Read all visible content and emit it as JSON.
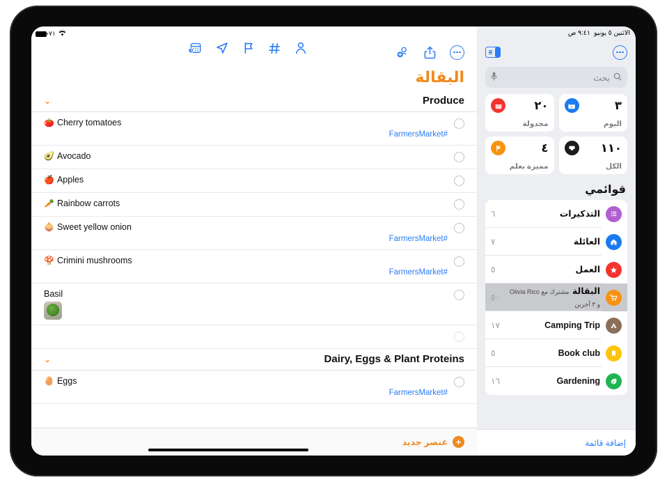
{
  "status_bar": {
    "battery_percent": "٧١",
    "battery_icon": "battery-icon",
    "wifi_icon": "wifi-icon",
    "time": "٩:٤١ ص",
    "date": "الاثنين ٥ يونيو"
  },
  "sidebar": {
    "more_button": "more-circle-icon",
    "sidebar_toggle": "sidebar-toggle-icon",
    "search": {
      "placeholder": "بحث",
      "search_icon": "search-icon",
      "mic_icon": "microphone-icon"
    },
    "widgets": [
      {
        "count": "٣",
        "label": "اليوم",
        "icon": "calendar-day-icon",
        "color": "#1a7af0"
      },
      {
        "count": "٢٠",
        "label": "مجدولة",
        "icon": "calendar-icon",
        "color": "#f5332e"
      },
      {
        "count": "١١٠",
        "label": "الكل",
        "icon": "inbox-icon",
        "color": "#1c1c1e"
      },
      {
        "count": "٤",
        "label": "مميزة بعلم",
        "icon": "flag-icon",
        "color": "#f79212"
      }
    ],
    "lists_title": "قوائمي",
    "lists": [
      {
        "name": "التذكيرات",
        "count": "٦",
        "icon": "list-bullet-icon",
        "color": "#b05ed0",
        "subtitle": "",
        "selected": false
      },
      {
        "name": "العائلة",
        "count": "٧",
        "icon": "house-icon",
        "color": "#1a7af0",
        "subtitle": "",
        "selected": false
      },
      {
        "name": "العمل",
        "count": "٥",
        "icon": "star-icon",
        "color": "#f5332e",
        "subtitle": "",
        "selected": false
      },
      {
        "name": "البقالة",
        "count": "٥٠",
        "icon": "shopping-cart-icon",
        "color": "#f79212",
        "subtitle": "مشترك مع Olivia Rico و ٣ آخرين",
        "selected": true
      },
      {
        "name": "Camping Trip",
        "count": "١٧",
        "icon": "tent-icon",
        "color": "#8a705a",
        "subtitle": "",
        "selected": false
      },
      {
        "name": "Book club",
        "count": "٥",
        "icon": "bookmark-icon",
        "color": "#fcc40a",
        "subtitle": "",
        "selected": false
      },
      {
        "name": "Gardening",
        "count": "١٦",
        "icon": "leaf-icon",
        "color": "#1fb552",
        "subtitle": "",
        "selected": false
      }
    ],
    "add_list_label": "إضافة قائمة"
  },
  "main": {
    "toolbar_left": [
      {
        "icon": "more-circle-icon"
      },
      {
        "icon": "share-icon"
      },
      {
        "icon": "add-person-icon"
      }
    ],
    "toolbar_mid": [
      {
        "icon": "person-icon"
      },
      {
        "icon": "hashtag-icon"
      },
      {
        "icon": "flag-icon"
      },
      {
        "icon": "location-arrow-icon"
      },
      {
        "icon": "calendar-clock-icon"
      }
    ],
    "title": "البقالة",
    "sections": [
      {
        "title": "Produce",
        "chevron": "chevron-down-icon",
        "items": [
          {
            "emoji": "🍅",
            "text": "Cherry tomatoes",
            "tag": "#FarmersMarket",
            "thumb": false,
            "faint": false
          },
          {
            "emoji": "🥑",
            "text": "Avocado",
            "tag": "",
            "thumb": false,
            "faint": false
          },
          {
            "emoji": "🍎",
            "text": "Apples",
            "tag": "",
            "thumb": false,
            "faint": false
          },
          {
            "emoji": "🥕",
            "text": "Rainbow carrots",
            "tag": "",
            "thumb": false,
            "faint": false
          },
          {
            "emoji": "🧅",
            "text": "Sweet yellow onion",
            "tag": "#FarmersMarket",
            "thumb": false,
            "faint": false
          },
          {
            "emoji": "🍄",
            "text": "Crimini mushrooms",
            "tag": "#FarmersMarket",
            "thumb": false,
            "faint": false
          },
          {
            "emoji": "",
            "text": "Basil",
            "tag": "",
            "thumb": true,
            "faint": false
          },
          {
            "emoji": "",
            "text": "",
            "tag": "",
            "thumb": false,
            "faint": true
          }
        ]
      },
      {
        "title": "Dairy, Eggs & Plant Proteins",
        "chevron": "chevron-down-icon",
        "items": [
          {
            "emoji": "🥚",
            "text": "Eggs",
            "tag": "#FarmersMarket",
            "thumb": false,
            "faint": false
          }
        ]
      }
    ],
    "new_item_label": "عنصر جديد",
    "add_icon": "plus-circle-icon"
  },
  "colors": {
    "accent_orange": "#f08a1e",
    "accent_blue": "#2b7cf6",
    "sidebar_bg": "#eceef2",
    "selected_row": "#c9cace"
  }
}
